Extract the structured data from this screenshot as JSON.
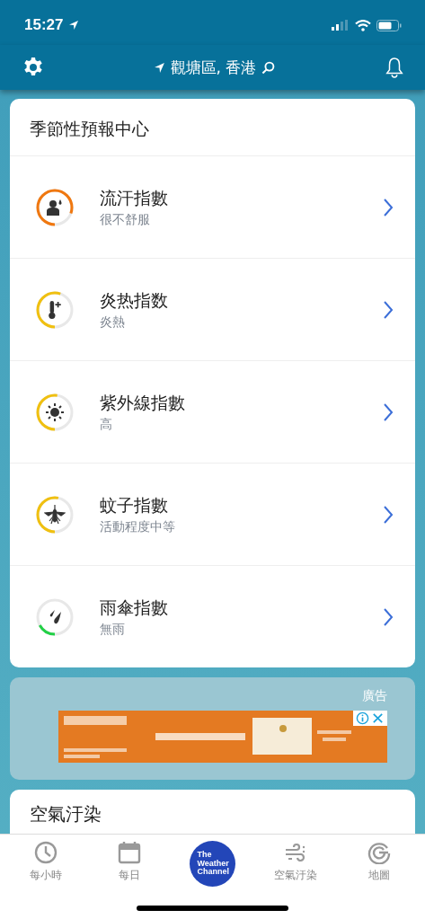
{
  "status_bar": {
    "time": "15:27"
  },
  "header": {
    "location": "觀塘區, 香港"
  },
  "seasonal_card": {
    "title": "季節性預報中心",
    "items": [
      {
        "kind": "sweat",
        "title": "流汗指數",
        "subtitle": "很不舒服",
        "color": "#f07810"
      },
      {
        "kind": "heat",
        "title": "炎热指数",
        "subtitle": "炎熱",
        "color": "#f0c010"
      },
      {
        "kind": "uv",
        "title": "紫外線指數",
        "subtitle": "高",
        "color": "#f0c010"
      },
      {
        "kind": "mosquito",
        "title": "蚊子指數",
        "subtitle": "活動程度中等",
        "color": "#f0c010"
      },
      {
        "kind": "umbrella",
        "title": "雨傘指數",
        "subtitle": "無雨",
        "color": "#22d046"
      }
    ]
  },
  "ad": {
    "label": "廣告"
  },
  "air_card": {
    "title": "空氣汙染"
  },
  "bottom_nav": [
    {
      "kind": "clock",
      "label": "每小時"
    },
    {
      "kind": "calendar",
      "label": "每日"
    },
    {
      "kind": "logo",
      "label": "The Weather Channel"
    },
    {
      "kind": "wind",
      "label": "空氣汙染"
    },
    {
      "kind": "radar",
      "label": "地圖"
    }
  ]
}
